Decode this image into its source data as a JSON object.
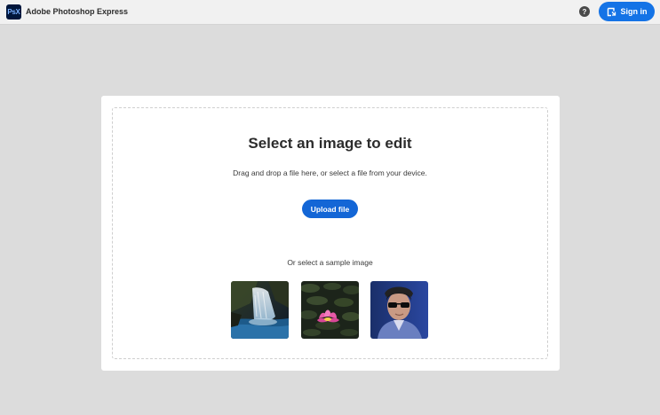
{
  "header": {
    "logo_text": "PsX",
    "app_title": "Adobe Photoshop Express",
    "help_icon": "question-circle-icon",
    "help_glyph": "?",
    "signin_label": "Sign in",
    "signin_icon": "sign-in-icon"
  },
  "upload": {
    "headline": "Select an image to edit",
    "subtext": "Drag and drop a file here, or select a file from your device.",
    "upload_label": "Upload file",
    "sample_label": "Or select a sample image"
  },
  "samples": [
    {
      "name": "waterfall"
    },
    {
      "name": "water-lily"
    },
    {
      "name": "man-with-sunglasses"
    }
  ],
  "colors": {
    "accent": "#1473e6",
    "background": "#dcdcdc",
    "topbar": "#f1f1f1",
    "card": "#ffffff"
  }
}
